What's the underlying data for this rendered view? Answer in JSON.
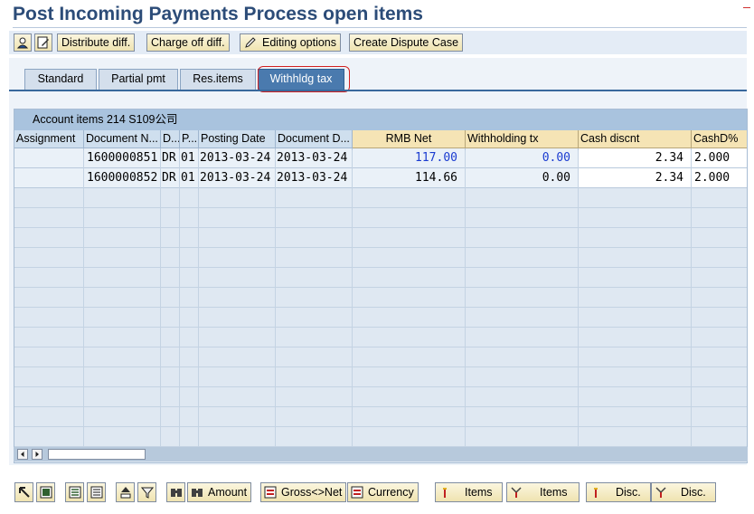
{
  "title": "Post Incoming Payments Process open items",
  "toolbar": {
    "distribute_diff": "Distribute diff.",
    "charge_off_diff": "Charge off diff.",
    "editing_options": "Editing options",
    "create_dispute_case": "Create Dispute Case"
  },
  "tabs": [
    {
      "label": "Standard"
    },
    {
      "label": "Partial pmt"
    },
    {
      "label": "Res.items"
    },
    {
      "label": "Withhldg tax",
      "active": true
    }
  ],
  "grid": {
    "title": "Account items 214 S109公司",
    "columns": [
      "Assignment",
      "Document N...",
      "D...",
      "P...",
      "Posting Date",
      "Document D...",
      "RMB Net",
      "Withholding tx",
      "Cash discnt",
      "CashD%"
    ],
    "rows": [
      {
        "assignment": "",
        "document_no": "1600000851",
        "d": "DR",
        "p": "01",
        "posting_date": "2013-03-24",
        "document_date": "2013-03-24",
        "rmb_net": "117.00",
        "withholding": "0.00",
        "cash_discount": "2.34",
        "cashd_pct": "2.000"
      },
      {
        "assignment": "",
        "document_no": "1600000852",
        "d": "DR",
        "p": "01",
        "posting_date": "2013-03-24",
        "document_date": "2013-03-24",
        "rmb_net": "114.66",
        "withholding": "0.00",
        "cash_discount": "2.34",
        "cashd_pct": "2.000"
      }
    ]
  },
  "bottom": {
    "amount": "Amount",
    "gross_net": "Gross<>Net",
    "currency": "Currency",
    "items_1": "Items",
    "items_2": "Items",
    "disc_1": "Disc.",
    "disc_2": "Disc."
  },
  "colors": {
    "title": "#2c4c78",
    "active_tab": "#4a7aae",
    "header": "#f5e4b5",
    "grid_title": "#a9c3de",
    "blue_value": "#1a3bd0"
  }
}
